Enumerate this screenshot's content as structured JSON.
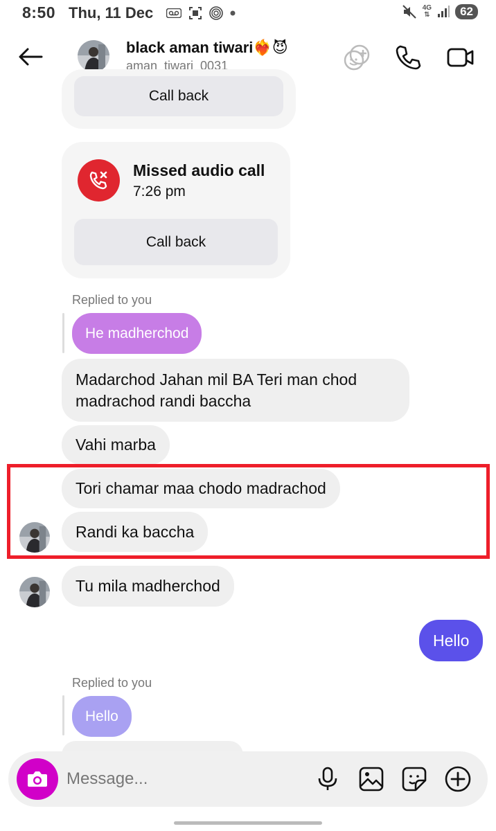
{
  "status_bar": {
    "time": "8:50",
    "date": "Thu, 11 Dec",
    "network": "4G",
    "battery": "62"
  },
  "header": {
    "name": "black aman tiwari❤️‍🔥😈",
    "username": "aman_tiwari_0031"
  },
  "messages": {
    "call_back_top": "Call back",
    "missed_call": {
      "title": "Missed audio call",
      "time": "7:26 pm",
      "button": "Call back"
    },
    "reply1": {
      "label": "Replied to you",
      "quoted": "He madherchod"
    },
    "msg1": "Madarchod Jahan mil BA Teri man chod madrachod randi baccha",
    "msg2": "Vahi marba",
    "msg3": "Tori chamar maa  chodo madrachod",
    "msg4": "Randi ka baccha",
    "msg5": "Tu mila madherchod",
    "sent1": "Hello",
    "reply2": {
      "label": "Replied to you",
      "quoted": "Hello"
    }
  },
  "composer": {
    "placeholder": "Message..."
  },
  "colors": {
    "sent_bubble": "#5b51ea",
    "reply_quote_1": "#c77de6",
    "reply_quote_2": "#a9a1f2",
    "missed_call_red": "#e0262f",
    "camera_button": "#d100c8",
    "highlight_red": "#ee1e2a"
  }
}
